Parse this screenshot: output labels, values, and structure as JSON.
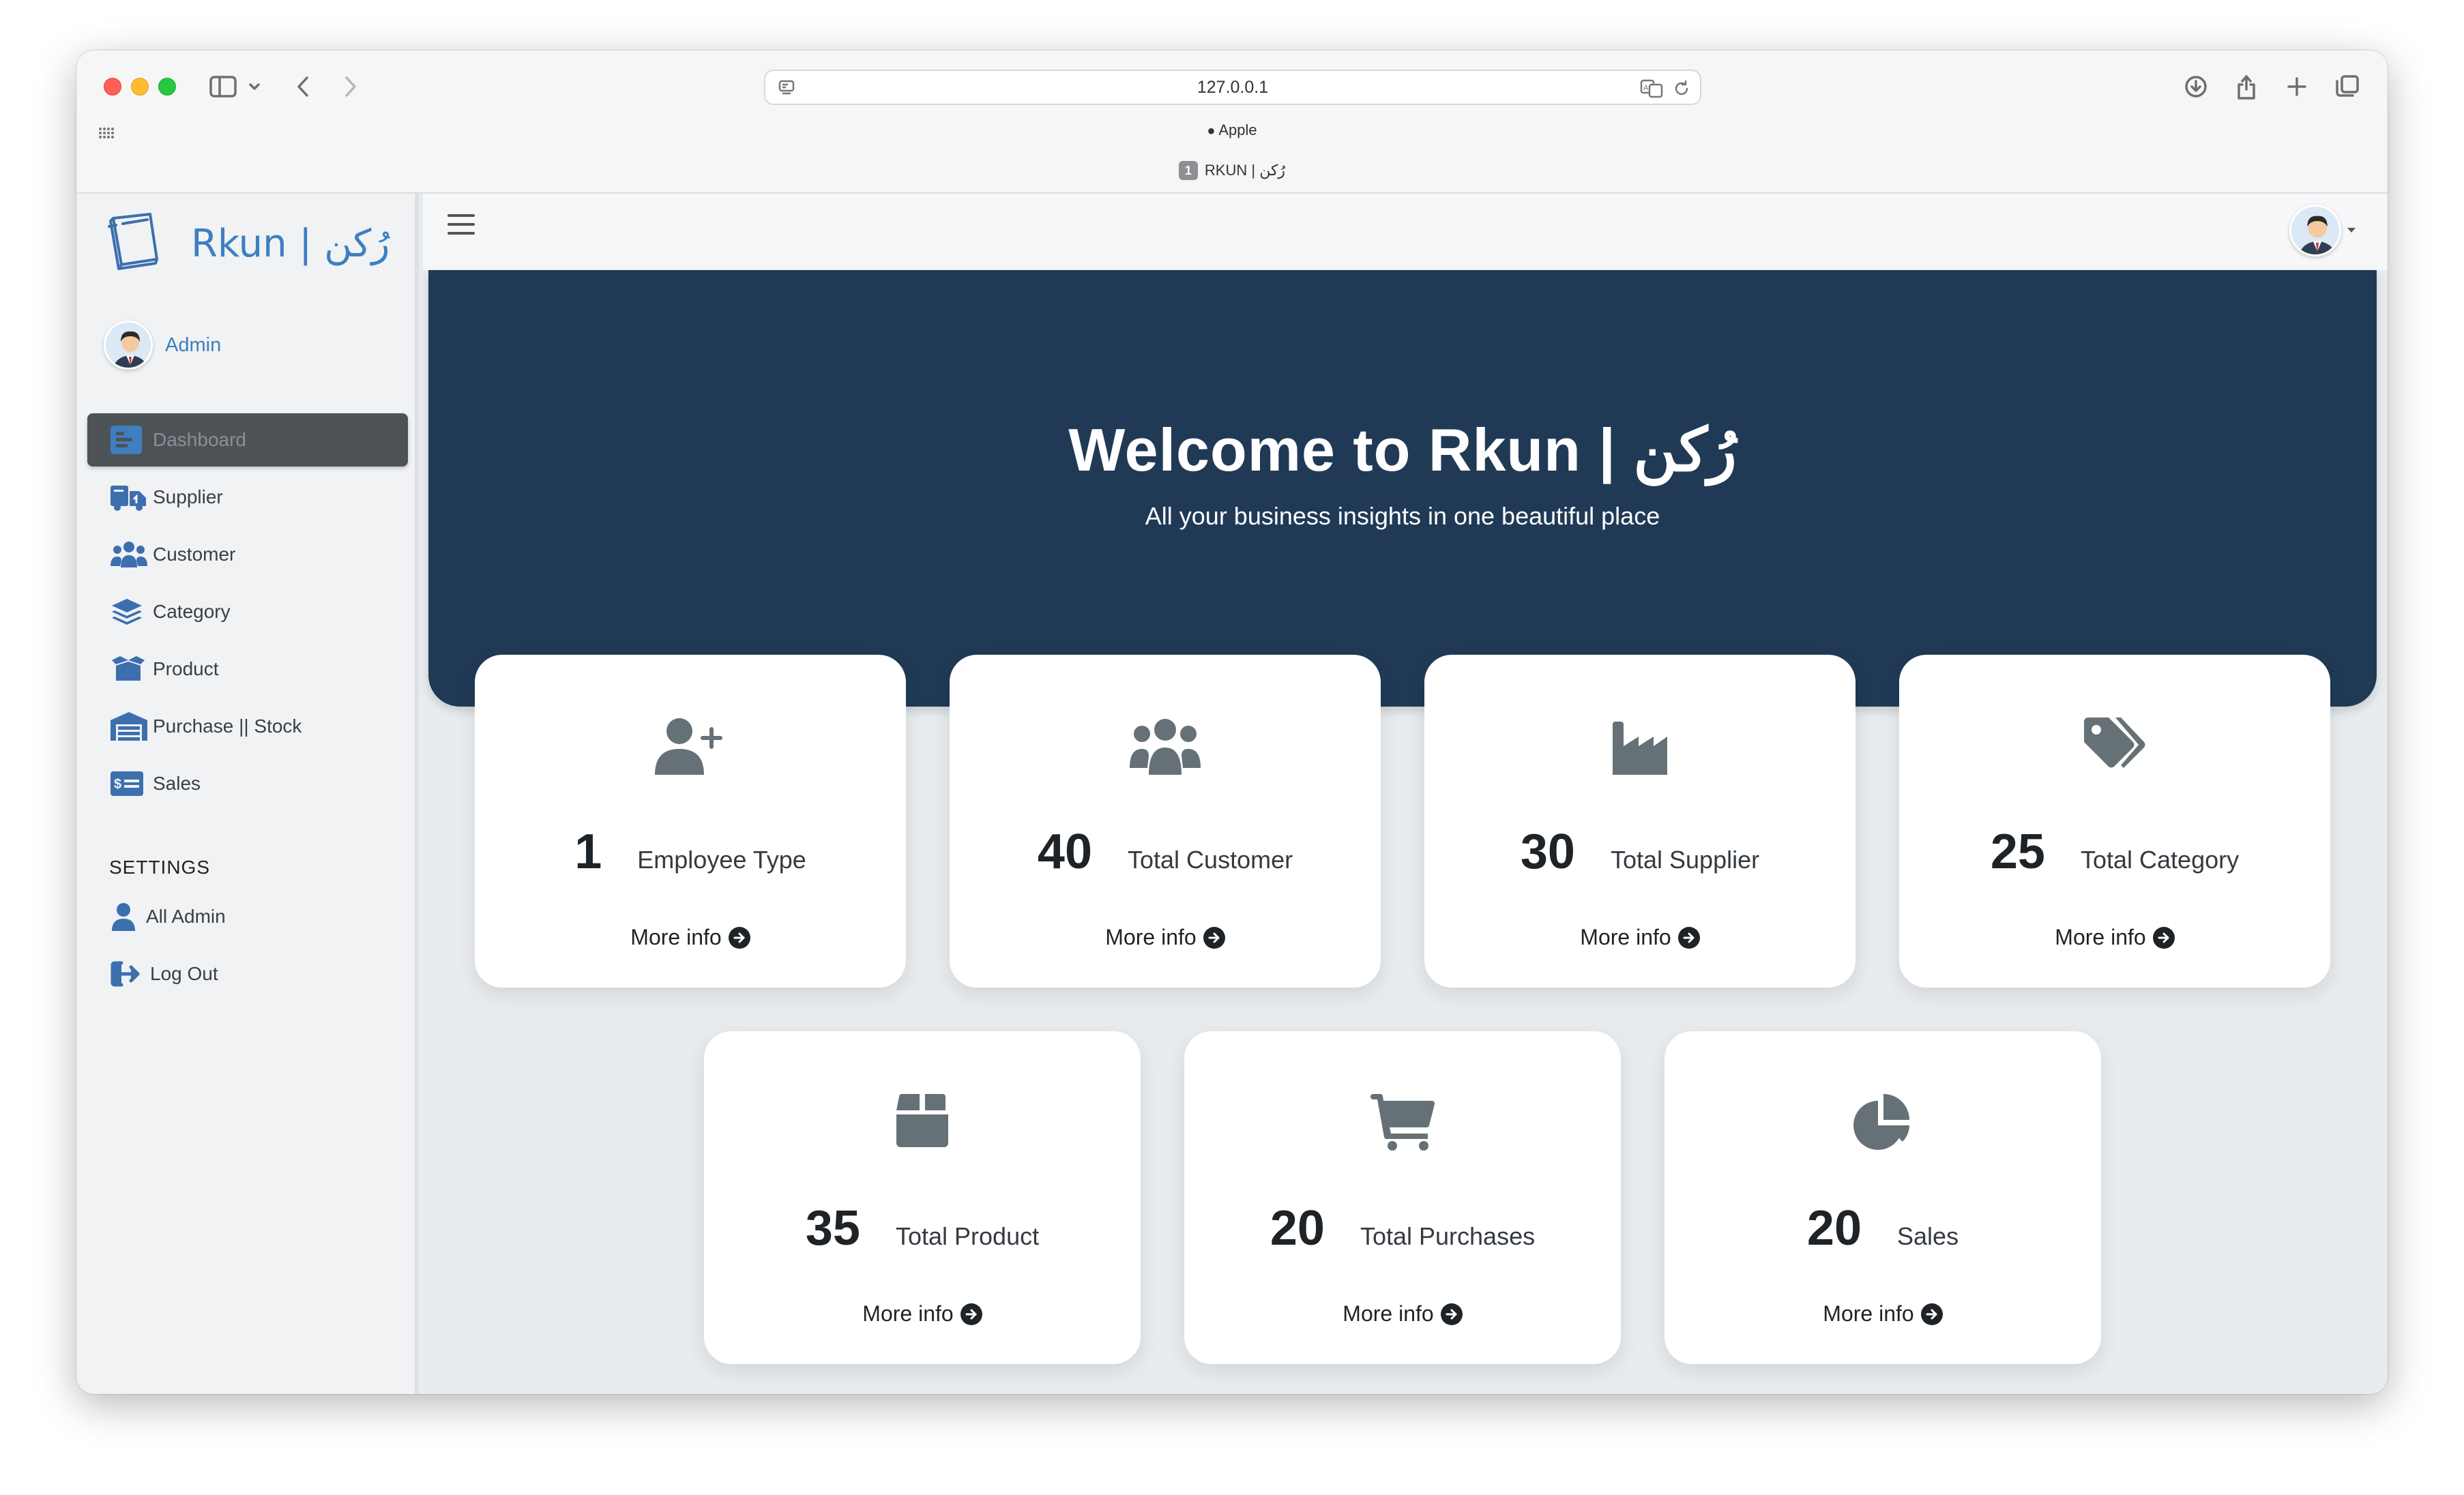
{
  "browser": {
    "url": "127.0.0.1",
    "favorites_label": "Apple",
    "tab_number": "1",
    "tab_title": "RKUN | رُكن"
  },
  "brand": {
    "name": "Rkun | رُكن"
  },
  "user": {
    "name": "Admin"
  },
  "sidebar": {
    "items": [
      {
        "label": "Dashboard",
        "icon": "dashboard-icon",
        "active": true
      },
      {
        "label": "Supplier",
        "icon": "supplier-truck-icon"
      },
      {
        "label": "Customer",
        "icon": "customers-icon"
      },
      {
        "label": "Category",
        "icon": "layers-icon"
      },
      {
        "label": "Product",
        "icon": "box-open-icon"
      },
      {
        "label": "Purchase || Stock",
        "icon": "warehouse-icon"
      },
      {
        "label": "Sales",
        "icon": "money-check-icon"
      }
    ],
    "settings_label": "SETTINGS",
    "settings_items": [
      {
        "label": "All Admin",
        "icon": "user-icon"
      },
      {
        "label": "Log Out",
        "icon": "logout-icon"
      }
    ]
  },
  "hero": {
    "title": "Welcome to Rkun | رُكن",
    "subtitle": "All your business insights in one beautiful place"
  },
  "cards": [
    {
      "value": "1",
      "label": "Employee Type",
      "more": "More info",
      "icon": "user-plus-icon"
    },
    {
      "value": "40",
      "label": "Total Customer",
      "more": "More info",
      "icon": "users-icon"
    },
    {
      "value": "30",
      "label": "Total Supplier",
      "more": "More info",
      "icon": "industry-icon"
    },
    {
      "value": "25",
      "label": "Total Category",
      "more": "More info",
      "icon": "tags-icon"
    },
    {
      "value": "35",
      "label": "Total Product",
      "more": "More info",
      "icon": "box-icon"
    },
    {
      "value": "20",
      "label": "Total Purchases",
      "more": "More info",
      "icon": "cart-icon"
    },
    {
      "value": "20",
      "label": "Sales",
      "more": "More info",
      "icon": "pie-chart-icon"
    }
  ],
  "colors": {
    "hero_bg": "#203a56",
    "brand_blue": "#3d7fc1",
    "active_nav_bg": "#4d5257",
    "card_icon": "#667177"
  }
}
